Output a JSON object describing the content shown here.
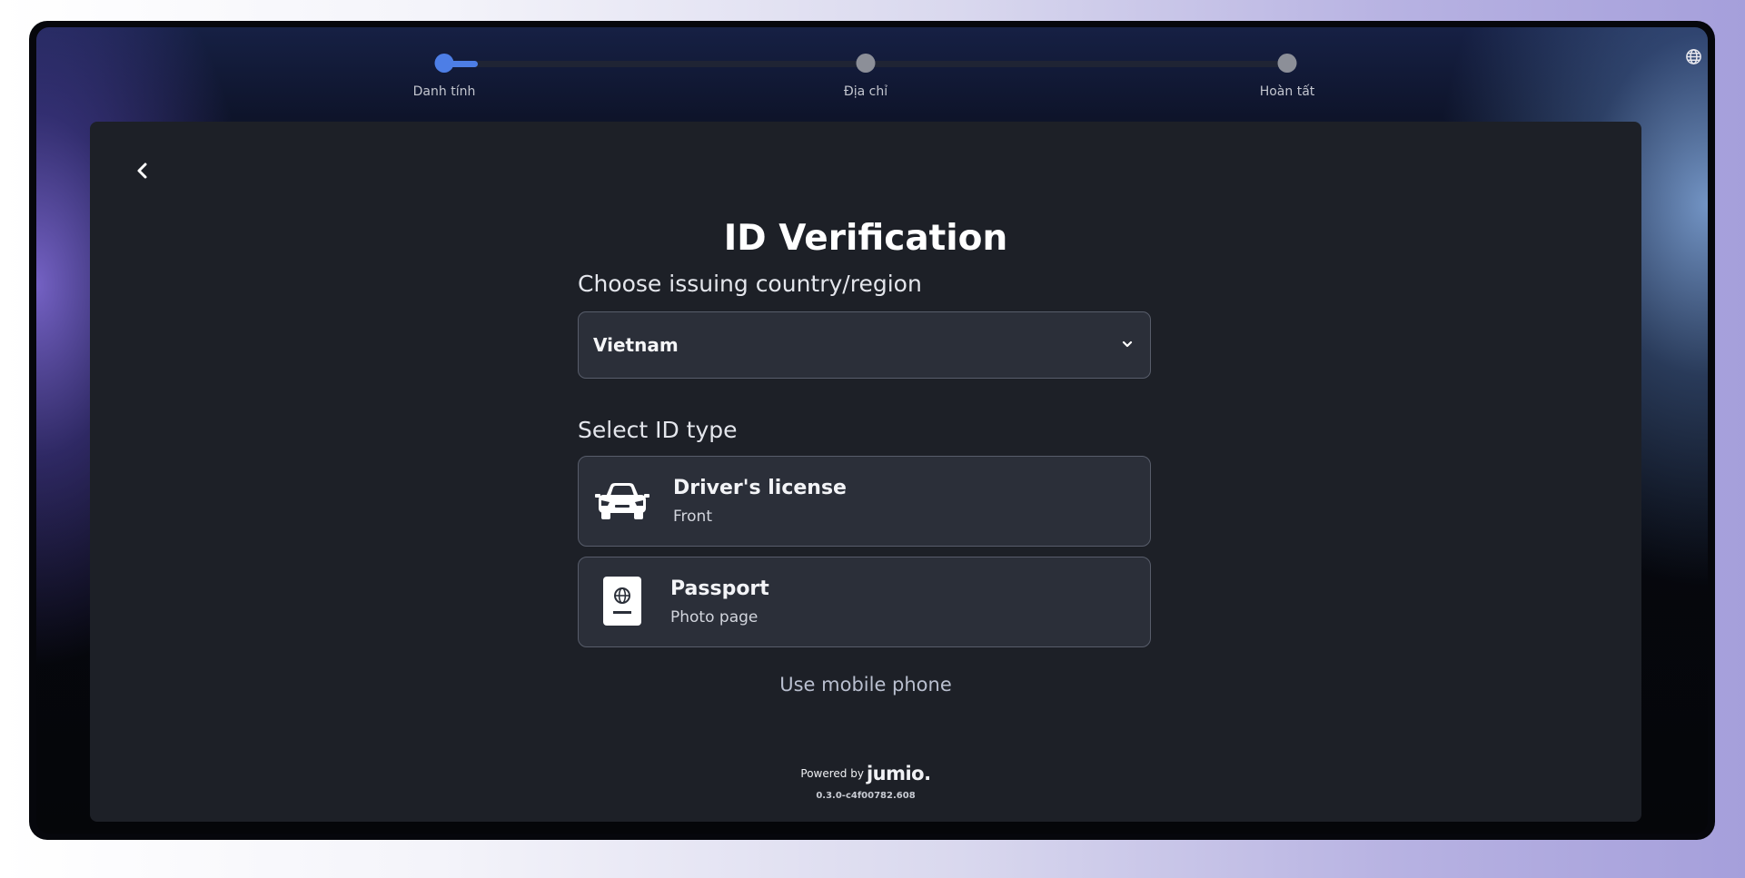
{
  "stepper": {
    "progress": 0.04,
    "steps": [
      {
        "label": "Danh tính",
        "state": "active"
      },
      {
        "label": "Địa chỉ",
        "state": "pending"
      },
      {
        "label": "Hoàn tất",
        "state": "pending"
      }
    ]
  },
  "header": {
    "language_icon": "globe-icon",
    "back_icon": "chevron-left-icon"
  },
  "main": {
    "title": "ID Verification",
    "country_label": "Choose issuing country/region",
    "country_select": {
      "value": "Vietnam",
      "icon": "chevron-down-icon"
    },
    "id_type_label": "Select ID type",
    "id_types": [
      {
        "title": "Driver's license",
        "subtitle": "Front",
        "icon": "car-icon"
      },
      {
        "title": "Passport",
        "subtitle": "Photo page",
        "icon": "passport-icon"
      }
    ],
    "mobile_link": "Use mobile phone"
  },
  "footer": {
    "powered_by": "Powered by",
    "brand": "jumio.",
    "version": "0.3.0-c4f00782.608"
  },
  "colors": {
    "accent": "#4d7ee6",
    "panel": "#1d2027",
    "card": "#2b2f39"
  }
}
